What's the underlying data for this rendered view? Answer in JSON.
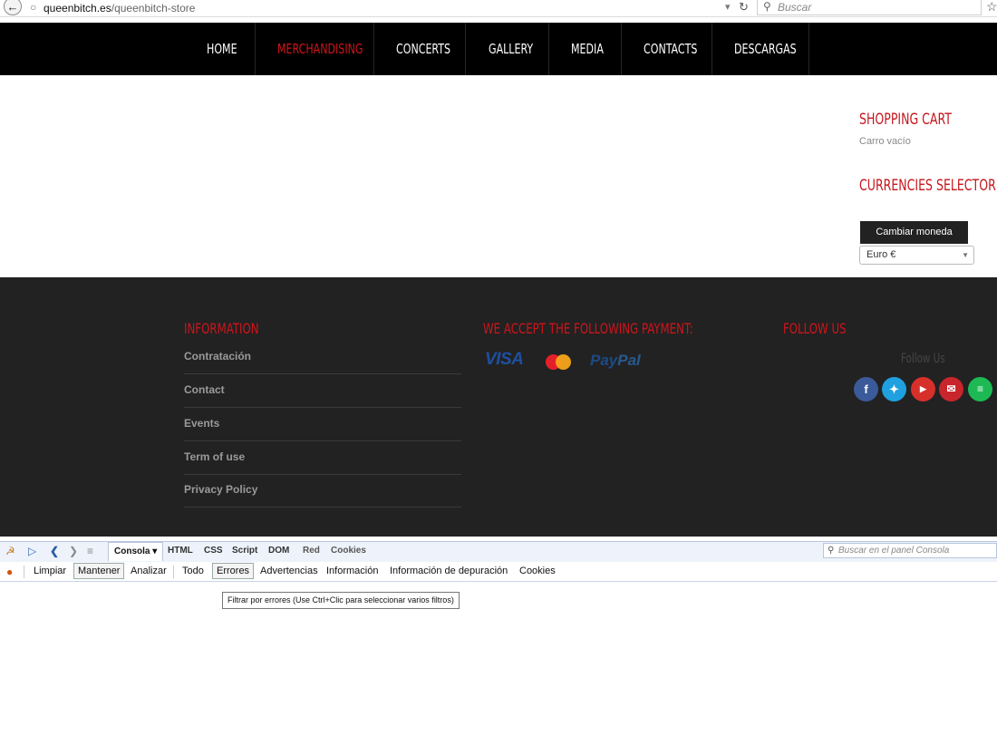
{
  "browser": {
    "url_host": "queenbitch.es",
    "url_path": "/queenbitch-store",
    "search_placeholder": "Buscar"
  },
  "nav": {
    "items": [
      "HOME",
      "MERCHANDISING",
      "CONCERTS",
      "GALLERY",
      "MEDIA",
      "CONTACTS",
      "DESCARGAS"
    ],
    "active": "MERCHANDISING"
  },
  "sidebar": {
    "cart_title": "SHOPPING CART",
    "cart_empty": "Carro vacío",
    "currency_title": "CURRENCIES SELECTOR",
    "change_button": "Cambiar moneda",
    "currency_value": "Euro €"
  },
  "footer": {
    "info_title": "INFORMATION",
    "info_links": [
      "Contratación",
      "Contact",
      "Events",
      "Term of use",
      "Privacy Policy"
    ],
    "payment_title": "WE ACCEPT THE FOLLOWING PAYMENT:",
    "payment_visa": "VISA",
    "payment_paypal_a": "Pay",
    "payment_paypal_b": "Pal",
    "follow_title": "FOLLOW US",
    "follow_label": "Follow Us",
    "social": [
      "facebook-icon",
      "twitter-icon",
      "youtube-icon",
      "email-icon",
      "spotify-icon"
    ]
  },
  "firebug": {
    "tabs": [
      "Consola",
      "HTML",
      "CSS",
      "Script",
      "DOM",
      "Red",
      "Cookies"
    ],
    "search_placeholder": "Buscar en el panel Consola",
    "toolbar": [
      "Limpiar",
      "Mantener",
      "Analizar",
      "Todo",
      "Errores",
      "Advertencias",
      "Información",
      "Información de depuración",
      "Cookies"
    ],
    "tooltip": "Filtrar por errores (Use Ctrl+Clic para seleccionar varios filtros)"
  },
  "colors": {
    "accent_red": "#d0141b",
    "nav_bg": "#000000",
    "footer_bg": "#222222"
  }
}
